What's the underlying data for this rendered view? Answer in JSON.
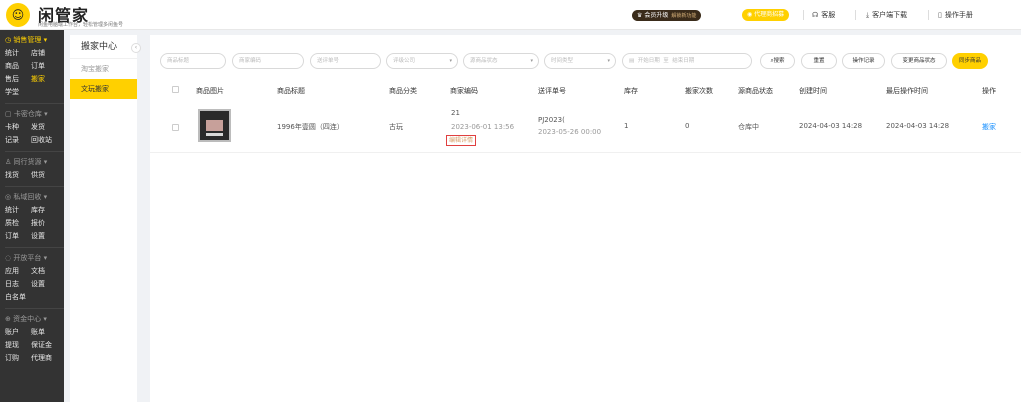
{
  "topbar": {
    "brand": "闲管家",
    "slogan": "闲鱼电脑端工作台，轻松管理多闲鱼号",
    "vip_label": "会员升级",
    "vip_sub": "解锁新功能",
    "agent_label": "代理商招募",
    "links": [
      "客服",
      "客户端下载",
      "操作手册"
    ]
  },
  "sidebar": {
    "groups": [
      {
        "head": "销售管理",
        "rows": [
          [
            "统计",
            "店铺"
          ],
          [
            "商品",
            "订单"
          ],
          [
            "售后",
            "搬家"
          ],
          [
            "学堂",
            ""
          ]
        ]
      },
      {
        "head": "卡密仓库",
        "rows": [
          [
            "卡种",
            "发货"
          ],
          [
            "记录",
            "回收站"
          ]
        ]
      },
      {
        "head": "同行货源",
        "rows": [
          [
            "找货",
            "供货"
          ]
        ]
      },
      {
        "head": "私域回收",
        "rows": [
          [
            "统计",
            "库存"
          ],
          [
            "质检",
            "报价"
          ],
          [
            "订单",
            "设置"
          ]
        ]
      },
      {
        "head": "开放平台",
        "rows": [
          [
            "应用",
            "文档"
          ],
          [
            "日志",
            "设置"
          ],
          [
            "白名单",
            ""
          ]
        ]
      },
      {
        "head": "资金中心",
        "rows": [
          [
            "账户",
            "账单"
          ],
          [
            "提现",
            "保证金"
          ],
          [
            "订购",
            "代理商"
          ]
        ]
      }
    ]
  },
  "subnav": {
    "title": "搬家中心",
    "items": [
      "淘宝搬家",
      "文玩搬家"
    ],
    "collapse": "‹"
  },
  "filters": {
    "product_title": "商品标题",
    "merchant_code": "商家编码",
    "grading_no": "送评单号",
    "grading_company": "评级公司",
    "source_status": "源商品状态",
    "time_type": "时间类型",
    "start_date": "开始日期",
    "to": "至",
    "end_date": "结束日期"
  },
  "buttons": {
    "search": "搜索",
    "reset": "重置",
    "operation_log": "操作记录",
    "change_status": "变更商品状态",
    "sync": "同步商品"
  },
  "table": {
    "headers": [
      "商品图片",
      "商品标题",
      "商品分类",
      "商家编码",
      "送评单号",
      "库存",
      "搬家次数",
      "源商品状态",
      "创建时间",
      "最后操作时间",
      "操作"
    ],
    "row": {
      "title": "1996年壹圆（四连）",
      "category": "古玩",
      "code": "21",
      "code_date": "2023-06-01 13:56",
      "code_link": "编辑详情",
      "grading_no": "PJ2023(",
      "grading_date": "2023-05-26 00:00",
      "stock": "1",
      "move_count": "0",
      "source_status": "仓库中",
      "created": "2024-04-03 14:28",
      "last_op": "2024-04-03 14:28",
      "action": "搬家"
    }
  },
  "colors": {
    "accent": "#ffd000",
    "sidebar_bg": "#333333",
    "link": "#1890ff",
    "highlight_border": "#e04040"
  }
}
